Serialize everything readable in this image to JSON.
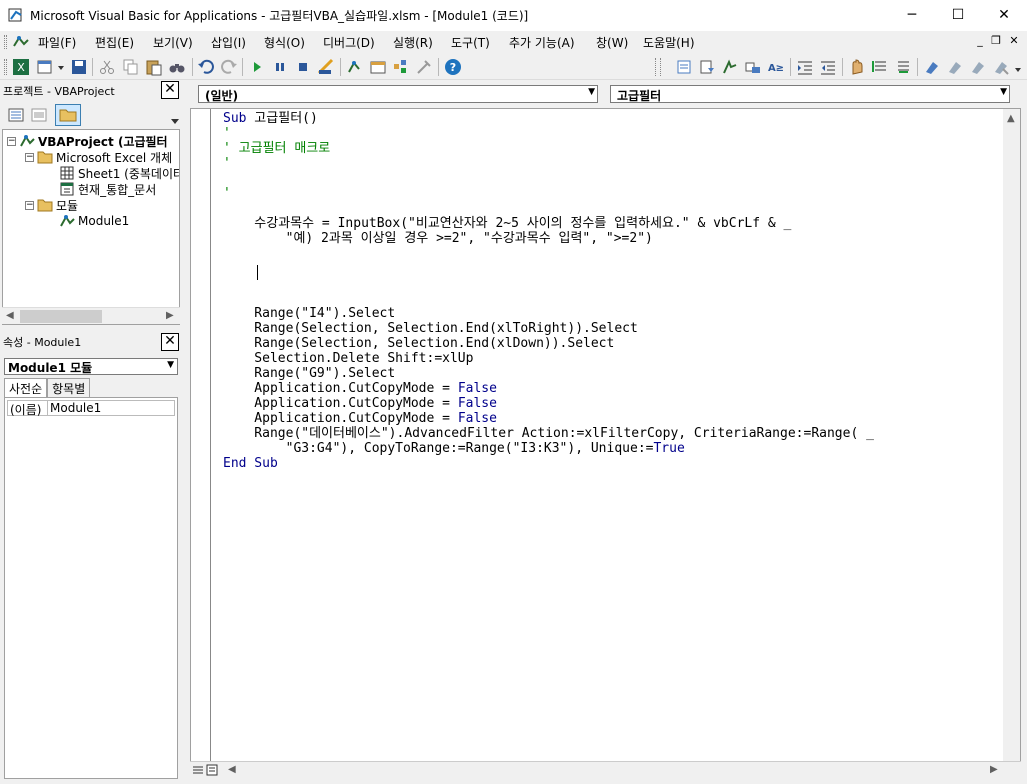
{
  "window": {
    "title": "Microsoft Visual Basic for Applications - 고급필터VBA_실습파일.xlsm - [Module1 (코드)]",
    "minimize": "─",
    "maximize": "☐",
    "close": "✕"
  },
  "menu": {
    "items": [
      "파일(F)",
      "편집(E)",
      "보기(V)",
      "삽입(I)",
      "형식(O)",
      "디버그(D)",
      "실행(R)",
      "도구(T)",
      "추가 기능(A)",
      "창(W)",
      "도움말(H)"
    ],
    "mdi_minimize": "_",
    "mdi_restore": "❐",
    "mdi_close": "✕"
  },
  "project_panel": {
    "title": "프로젝트 - VBAProject",
    "close": "✕",
    "tree": [
      {
        "label": "VBAProject (고급필터",
        "bold": true,
        "expander": "−"
      },
      {
        "label": "Microsoft Excel 개체",
        "expander": "−"
      },
      {
        "label": "Sheet1 (중복데이터"
      },
      {
        "label": "현재_통합_문서"
      },
      {
        "label": "모듈",
        "expander": "−"
      },
      {
        "label": "Module1"
      }
    ]
  },
  "properties_panel": {
    "title": "속성 - Module1",
    "close": "✕",
    "object_combo": "Module1 모듈",
    "tabs": [
      "사전순",
      "항목별"
    ],
    "rows": [
      {
        "key": "(이름)",
        "value": "Module1"
      }
    ]
  },
  "code_editor": {
    "object_combo": "(일반)",
    "procedure_combo": "고급필터",
    "lines": [
      [
        {
          "t": "Sub",
          "c": "kw"
        },
        {
          "t": " 고급필터()"
        }
      ],
      [
        {
          "t": "'",
          "c": "cm"
        }
      ],
      [
        {
          "t": "' 고급필터 매크로",
          "c": "cm"
        }
      ],
      [
        {
          "t": "'",
          "c": "cm"
        }
      ],
      [],
      [
        {
          "t": "'",
          "c": "cm"
        }
      ],
      [],
      [
        {
          "t": "    수강과목수 = InputBox(\"비교연산자와 2~5 사이의 정수를 입력하세요.\" & vbCrLf & _"
        }
      ],
      [
        {
          "t": "        \"예) 2과목 이상일 경우 >=2\", \"수강과목수 입력\", \">=2\")"
        }
      ],
      [],
      [],
      [],
      [],
      [
        {
          "t": "    Range(\"I4\").Select"
        }
      ],
      [
        {
          "t": "    Range(Selection, Selection.End(xlToRight)).Select"
        }
      ],
      [
        {
          "t": "    Range(Selection, Selection.End(xlDown)).Select"
        }
      ],
      [
        {
          "t": "    Selection.Delete Shift:=xlUp"
        }
      ],
      [
        {
          "t": "    Range(\"G9\").Select"
        }
      ],
      [
        {
          "t": "    Application.CutCopyMode = "
        },
        {
          "t": "False",
          "c": "kw"
        }
      ],
      [
        {
          "t": "    Application.CutCopyMode = "
        },
        {
          "t": "False",
          "c": "kw"
        }
      ],
      [
        {
          "t": "    Application.CutCopyMode = "
        },
        {
          "t": "False",
          "c": "kw"
        }
      ],
      [
        {
          "t": "    Range(\"데이터베이스\").AdvancedFilter Action:=xlFilterCopy, CriteriaRange:=Range( _"
        }
      ],
      [
        {
          "t": "        \"G3:G4\"), CopyToRange:=Range(\"I3:K3\"), Unique:="
        },
        {
          "t": "True",
          "c": "kw"
        }
      ],
      [
        {
          "t": "End Sub",
          "c": "kw"
        }
      ]
    ]
  },
  "colors": {
    "keyword": "#00008b",
    "comment": "#008000",
    "accent": "#1e73be"
  }
}
